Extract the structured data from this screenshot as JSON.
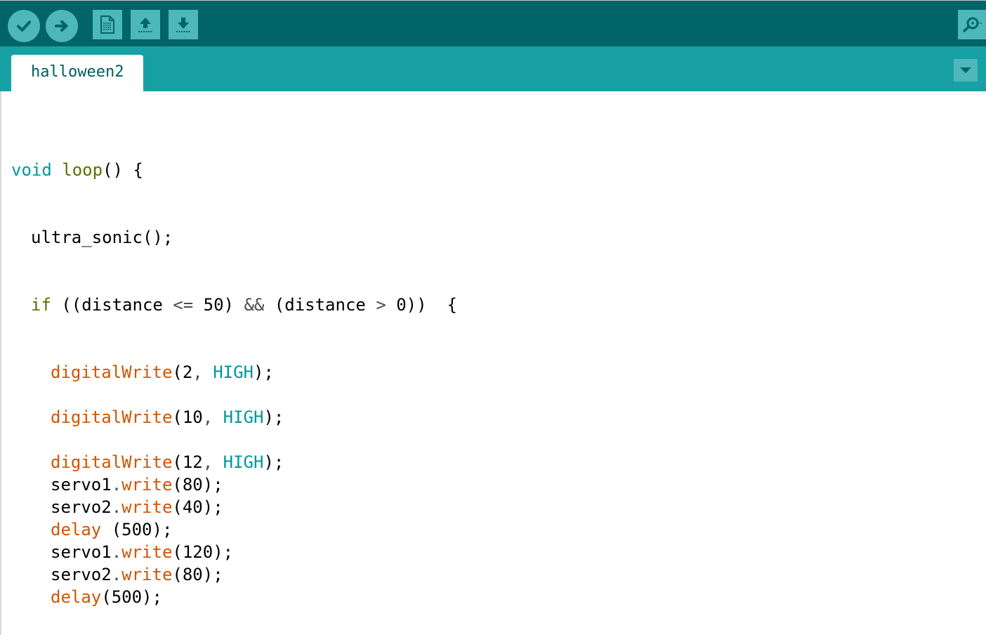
{
  "toolbar": {
    "buttons": [
      {
        "name": "verify",
        "icon": "checkmark-icon"
      },
      {
        "name": "upload",
        "icon": "arrow-right-icon"
      },
      {
        "name": "new",
        "icon": "new-document-icon"
      },
      {
        "name": "open",
        "icon": "open-arrow-up-icon"
      },
      {
        "name": "save",
        "icon": "save-arrow-down-icon"
      }
    ],
    "serial_monitor_icon": "magnifier-icon"
  },
  "tabs": [
    {
      "label": "halloween2",
      "active": true
    }
  ],
  "tab_menu_icon": "triangle-down-icon",
  "colors": {
    "toolbar_bg": "#006468",
    "tabbar_bg": "#17a1a5",
    "button_bg": "#4db7bb",
    "keyword": "#00979c",
    "function": "#5e6d03",
    "builtin": "#d35400",
    "plain": "#000000",
    "operator": "#434f54"
  },
  "editor": {
    "lines": [
      {
        "indent": 0,
        "tokens": [
          {
            "text": "void",
            "kind": "keyword"
          },
          {
            "text": " ",
            "kind": "plain"
          },
          {
            "text": "loop",
            "kind": "function"
          },
          {
            "text": "() {",
            "kind": "plain"
          }
        ]
      },
      {
        "indent": 1,
        "tokens": [
          {
            "text": "ultra_sonic();",
            "kind": "plain"
          }
        ]
      },
      {
        "indent": 1,
        "tokens": [
          {
            "text": "if",
            "kind": "function"
          },
          {
            "text": " ((distance ",
            "kind": "plain"
          },
          {
            "text": "<=",
            "kind": "operator"
          },
          {
            "text": " 50) ",
            "kind": "plain"
          },
          {
            "text": "&&",
            "kind": "operator"
          },
          {
            "text": " (distance ",
            "kind": "plain"
          },
          {
            "text": ">",
            "kind": "operator"
          },
          {
            "text": " 0))  {",
            "kind": "plain"
          }
        ]
      },
      {
        "indent": 2,
        "tokens": [
          {
            "text": "digitalWrite",
            "kind": "builtin"
          },
          {
            "text": "(2",
            "kind": "plain"
          },
          {
            "text": ",",
            "kind": "operator"
          },
          {
            "text": " ",
            "kind": "plain"
          },
          {
            "text": "HIGH",
            "kind": "keyword"
          },
          {
            "text": ");",
            "kind": "plain"
          }
        ]
      },
      {
        "indent": 2,
        "tokens": [
          {
            "text": "digitalWrite",
            "kind": "builtin"
          },
          {
            "text": "(10",
            "kind": "plain"
          },
          {
            "text": ",",
            "kind": "operator"
          },
          {
            "text": " ",
            "kind": "plain"
          },
          {
            "text": "HIGH",
            "kind": "keyword"
          },
          {
            "text": ");",
            "kind": "plain"
          }
        ]
      },
      {
        "indent": 2,
        "tokens": [
          {
            "text": "digitalWrite",
            "kind": "builtin"
          },
          {
            "text": "(12",
            "kind": "plain"
          },
          {
            "text": ",",
            "kind": "operator"
          },
          {
            "text": " ",
            "kind": "plain"
          },
          {
            "text": "HIGH",
            "kind": "keyword"
          },
          {
            "text": ");",
            "kind": "plain"
          }
        ]
      },
      {
        "indent": 2,
        "tokens": [
          {
            "text": "servo1",
            "kind": "plain"
          },
          {
            "text": ".",
            "kind": "operator"
          },
          {
            "text": "write",
            "kind": "builtin"
          },
          {
            "text": "(80);",
            "kind": "plain"
          }
        ]
      },
      {
        "indent": 2,
        "tokens": [
          {
            "text": "servo2",
            "kind": "plain"
          },
          {
            "text": ".",
            "kind": "operator"
          },
          {
            "text": "write",
            "kind": "builtin"
          },
          {
            "text": "(40);",
            "kind": "plain"
          }
        ]
      },
      {
        "indent": 2,
        "tokens": [
          {
            "text": "delay",
            "kind": "builtin"
          },
          {
            "text": " (500);",
            "kind": "plain"
          }
        ]
      },
      {
        "indent": 2,
        "tokens": [
          {
            "text": "servo1",
            "kind": "plain"
          },
          {
            "text": ".",
            "kind": "operator"
          },
          {
            "text": "write",
            "kind": "builtin"
          },
          {
            "text": "(120);",
            "kind": "plain"
          }
        ]
      },
      {
        "indent": 2,
        "tokens": [
          {
            "text": "servo2",
            "kind": "plain"
          },
          {
            "text": ".",
            "kind": "operator"
          },
          {
            "text": "write",
            "kind": "builtin"
          },
          {
            "text": "(80);",
            "kind": "plain"
          }
        ]
      },
      {
        "indent": 2,
        "tokens": [
          {
            "text": "delay",
            "kind": "builtin"
          },
          {
            "text": "(500);",
            "kind": "plain"
          }
        ]
      }
    ]
  }
}
